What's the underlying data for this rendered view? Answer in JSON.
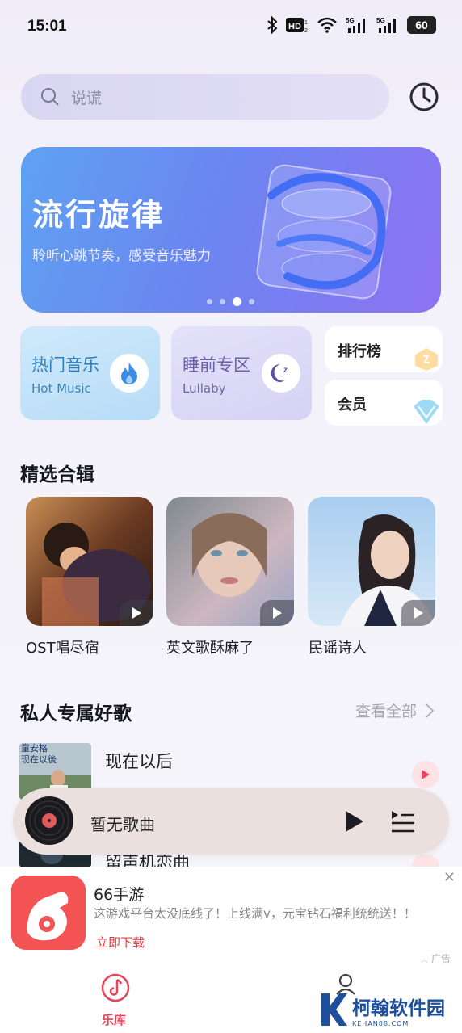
{
  "status_bar": {
    "time": "15:01",
    "battery": "60"
  },
  "search": {
    "placeholder": "说谎"
  },
  "banner": {
    "title": "流行旋律",
    "subtitle": "聆听心跳节奏，感受音乐魅力"
  },
  "categories": [
    {
      "title": "热门音乐",
      "subtitle": "Hot Music"
    },
    {
      "title": "睡前专区",
      "subtitle": "Lullaby"
    }
  ],
  "shortcuts": [
    {
      "label": "排行榜"
    },
    {
      "label": "会员"
    }
  ],
  "featured": {
    "title": "精选合辑",
    "albums": [
      {
        "name": "OST唱尽宿"
      },
      {
        "name": "英文歌酥麻了"
      },
      {
        "name": "民谣诗人"
      }
    ]
  },
  "personal": {
    "title": "私人专属好歌",
    "see_all": "查看全部",
    "songs": [
      {
        "title": "现在以后"
      },
      {
        "title": "留声机恋曲"
      }
    ],
    "thumb_text": "童安格\n现在以後"
  },
  "player": {
    "now_playing": "暂无歌曲"
  },
  "ad": {
    "app_name": "66手游",
    "description": "这游戏平台太没底线了！上线满v，元宝钻石福利统统送！！",
    "cta": "立即下载",
    "label": "广告",
    "close": "✕"
  },
  "nav": {
    "library_label": "乐库"
  },
  "watermark": {
    "name": "柯翰软件园",
    "domain": "KEHAN88.COM"
  },
  "colors": {
    "accent": "#e8435a",
    "banner_start": "#5ea2f2",
    "banner_end": "#8d72f2"
  }
}
